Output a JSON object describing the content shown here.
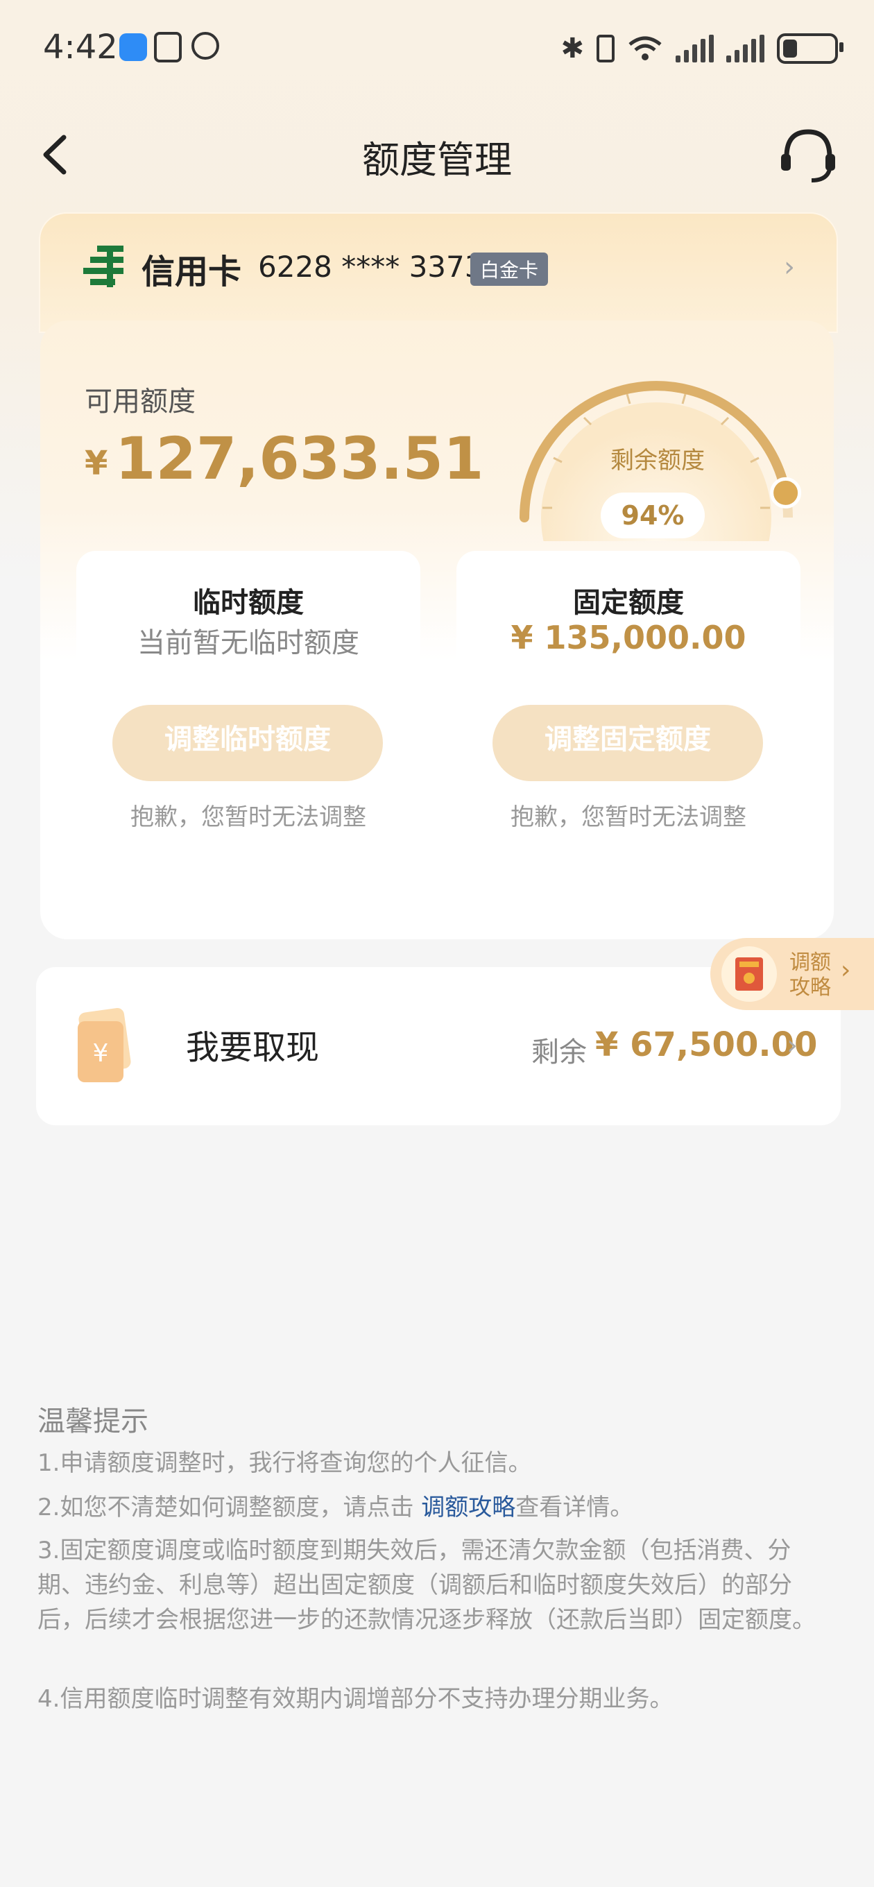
{
  "status_bar": {
    "time": "4:42"
  },
  "nav": {
    "title": "额度管理"
  },
  "card": {
    "name": "信用卡",
    "number": "6228 **** 3373",
    "badge": "白金卡"
  },
  "available": {
    "label": "可用额度",
    "currency": "¥",
    "value": "127,633.51"
  },
  "gauge": {
    "label": "剩余额度",
    "percent_text": "94%",
    "percent": 94
  },
  "temp_limit": {
    "title": "临时额度",
    "desc": "当前暂无临时额度",
    "button": "调整临时额度",
    "note": "抱歉，您暂时无法调整"
  },
  "fixed_limit": {
    "title": "固定额度",
    "amount": "¥ 135,000.00",
    "button": "调整固定额度",
    "note": "抱歉，您暂时无法调整"
  },
  "strategy_tab": {
    "line1": "调额",
    "line2": "攻略"
  },
  "withdraw": {
    "title": "我要取现",
    "prefix": "剩余",
    "amount": "¥ 67,500.00"
  },
  "tips": {
    "title": "温馨提示",
    "t1": "1.申请额度调整时，我行将查询您的个人征信。",
    "t2_pre": "2.如您不清楚如何调整额度，请点击 ",
    "t2_link": "调额攻略",
    "t2_post": "查看详情。",
    "t3": "3.固定额度调度或临时额度到期失效后，需还清欠款金额（包括消费、分期、违约金、利息等）超出固定额度（调额后和临时额度失效后）的部分后，后续才会根据您进一步的还款情况逐步释放（还款后当即）固定额度。",
    "t4": "4.信用额度临时调整有效期内调增部分不支持办理分期业务。"
  },
  "colors": {
    "gold": "#c09146",
    "link": "#2a5a9c",
    "button_disabled": "#f5e1c2"
  }
}
